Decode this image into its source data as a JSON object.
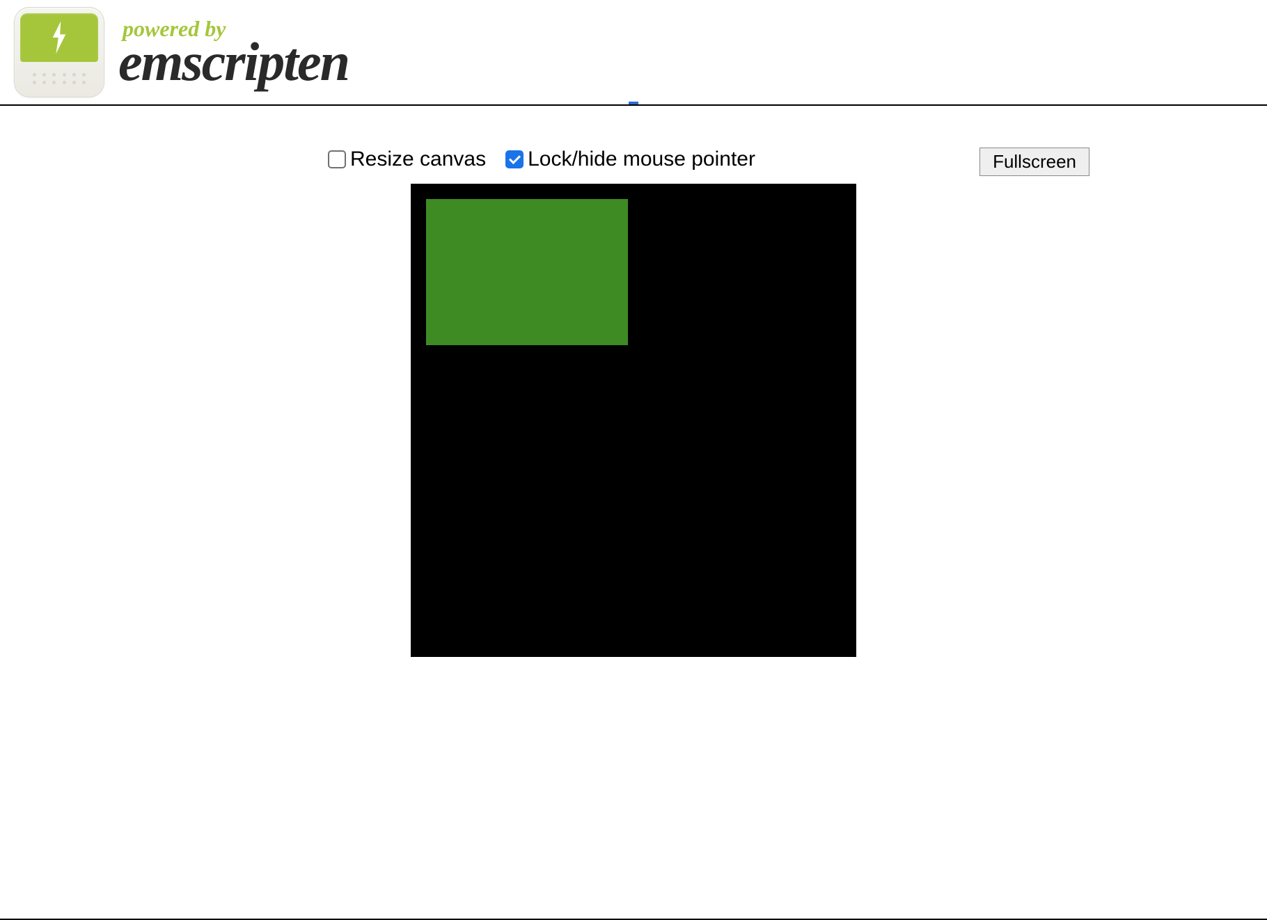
{
  "header": {
    "powered_by": "powered by",
    "brand": "emscripten"
  },
  "controls": {
    "resize_label": "Resize canvas",
    "resize_checked": false,
    "lock_label": "Lock/hide mouse pointer",
    "lock_checked": true,
    "fullscreen_label": "Fullscreen"
  },
  "canvas": {
    "background": "#000000",
    "rect_color": "#3e8b24"
  }
}
